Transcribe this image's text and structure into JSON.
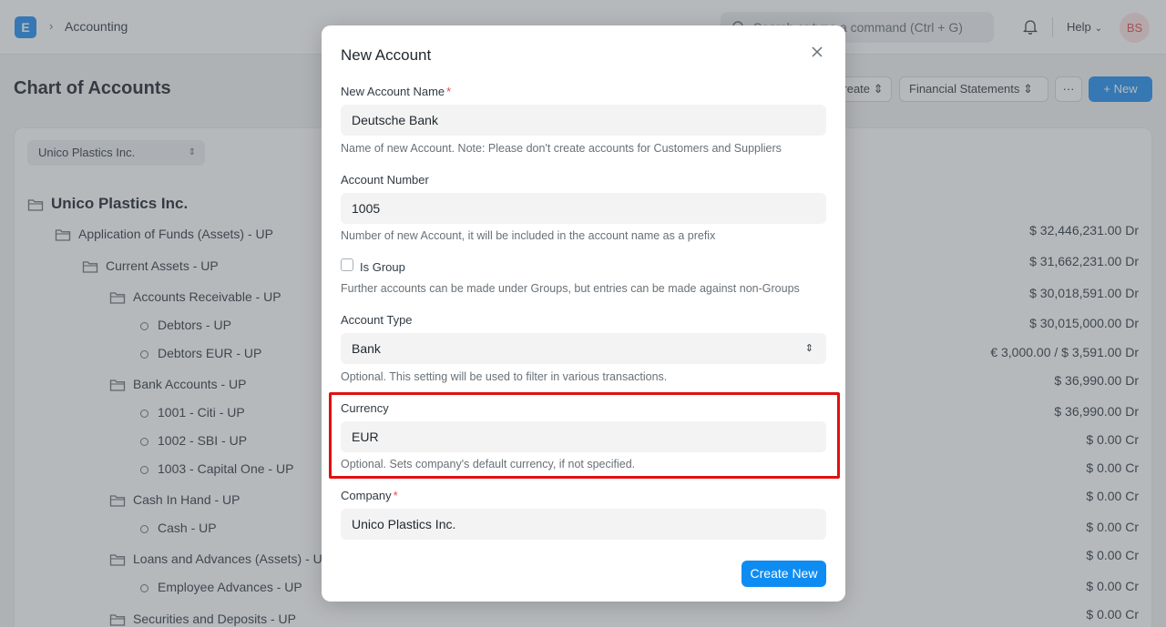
{
  "navbar": {
    "logo_letter": "E",
    "breadcrumb": "Accounting",
    "search_placeholder": "Search or type a command (Ctrl + G)",
    "help_label": "Help",
    "avatar_initials": "BS"
  },
  "page": {
    "title": "Chart of Accounts",
    "create_label": "Create",
    "financial_statements_label": "Financial Statements",
    "more_label": "···",
    "new_label": "+ New",
    "company_filter": "Unico Plastics Inc."
  },
  "tree": {
    "rows": [
      {
        "label": "Unico Plastics Inc.",
        "balance": ""
      },
      {
        "label": "Application of Funds (Assets) - UP",
        "balance": "$ 32,446,231.00 Dr"
      },
      {
        "label": "Current Assets - UP",
        "balance": "$ 31,662,231.00 Dr"
      },
      {
        "label": "Accounts Receivable - UP",
        "balance": "$ 30,018,591.00 Dr"
      },
      {
        "label": "Debtors - UP",
        "balance": "$ 30,015,000.00 Dr"
      },
      {
        "label": "Debtors EUR - UP",
        "balance": "€ 3,000.00 / $ 3,591.00 Dr"
      },
      {
        "label": "Bank Accounts - UP",
        "balance": "$ 36,990.00 Dr"
      },
      {
        "label": "1001 - Citi - UP",
        "balance": "$ 36,990.00 Dr"
      },
      {
        "label": "1002 - SBI - UP",
        "balance": "$ 0.00 Cr"
      },
      {
        "label": "1003 - Capital One - UP",
        "balance": "$ 0.00 Cr"
      },
      {
        "label": "Cash In Hand - UP",
        "balance": "$ 0.00 Cr"
      },
      {
        "label": "Cash - UP",
        "balance": "$ 0.00 Cr"
      },
      {
        "label": "Loans and Advances (Assets) - UP",
        "balance": "$ 0.00 Cr"
      },
      {
        "label": "Employee Advances - UP",
        "balance": "$ 0.00 Cr"
      },
      {
        "label": "Securities and Deposits - UP",
        "balance": "$ 0.00 Cr"
      }
    ]
  },
  "dialog": {
    "title": "New Account",
    "account_name_label": "New Account Name",
    "required_mark": "*",
    "account_name_value": "Deutsche Bank",
    "account_name_desc": "Name of new Account. Note: Please don't create accounts for Customers and Suppliers",
    "account_number_label": "Account Number",
    "account_number_value": "1005",
    "account_number_desc": "Number of new Account, it will be included in the account name as a prefix",
    "is_group_label": "Is Group",
    "is_group_checked": false,
    "is_group_desc": "Further accounts can be made under Groups, but entries can be made against non-Groups",
    "account_type_label": "Account Type",
    "account_type_value": "Bank",
    "account_type_desc": "Optional. This setting will be used to filter in various transactions.",
    "currency_label": "Currency",
    "currency_value": "EUR",
    "currency_desc": "Optional. Sets company's default currency, if not specified.",
    "company_label": "Company",
    "company_value": "Unico Plastics Inc.",
    "create_button": "Create New"
  },
  "colors": {
    "primary": "#2490ef",
    "highlight": "#e01010",
    "required": "#e24c4c"
  }
}
